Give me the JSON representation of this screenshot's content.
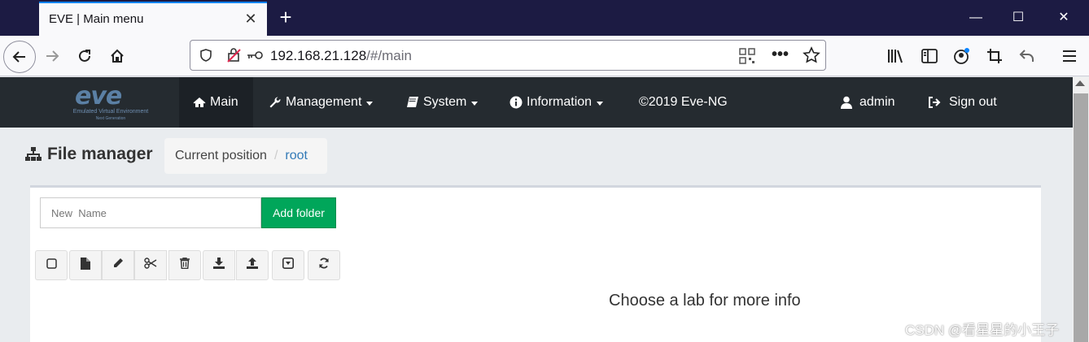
{
  "browser": {
    "tab_title": "EVE | Main menu",
    "url_host": "192.168.21.128",
    "url_path": "/#/main"
  },
  "app": {
    "logo_text": "eve",
    "logo_sub": "Emulated Virtual Environment",
    "logo_sub2": "Next Generation",
    "menu": {
      "main": "Main",
      "management": "Management",
      "system": "System",
      "information": "Information",
      "copyright": "©2019 Eve-NG",
      "user": "admin",
      "signout": "Sign out"
    }
  },
  "file_manager": {
    "title": "File manager",
    "breadcrumb_label": "Current position",
    "breadcrumb_sep": "/",
    "breadcrumb_root": "root",
    "name_placeholder": "New  Name",
    "add_folder_label": "Add folder",
    "lab_info": "Choose a lab for more info"
  },
  "watermark": "CSDN @看星星的小王子",
  "colors": {
    "header_bg": "#252b30",
    "add_folder": "#00a65a",
    "link": "#337ab7"
  }
}
